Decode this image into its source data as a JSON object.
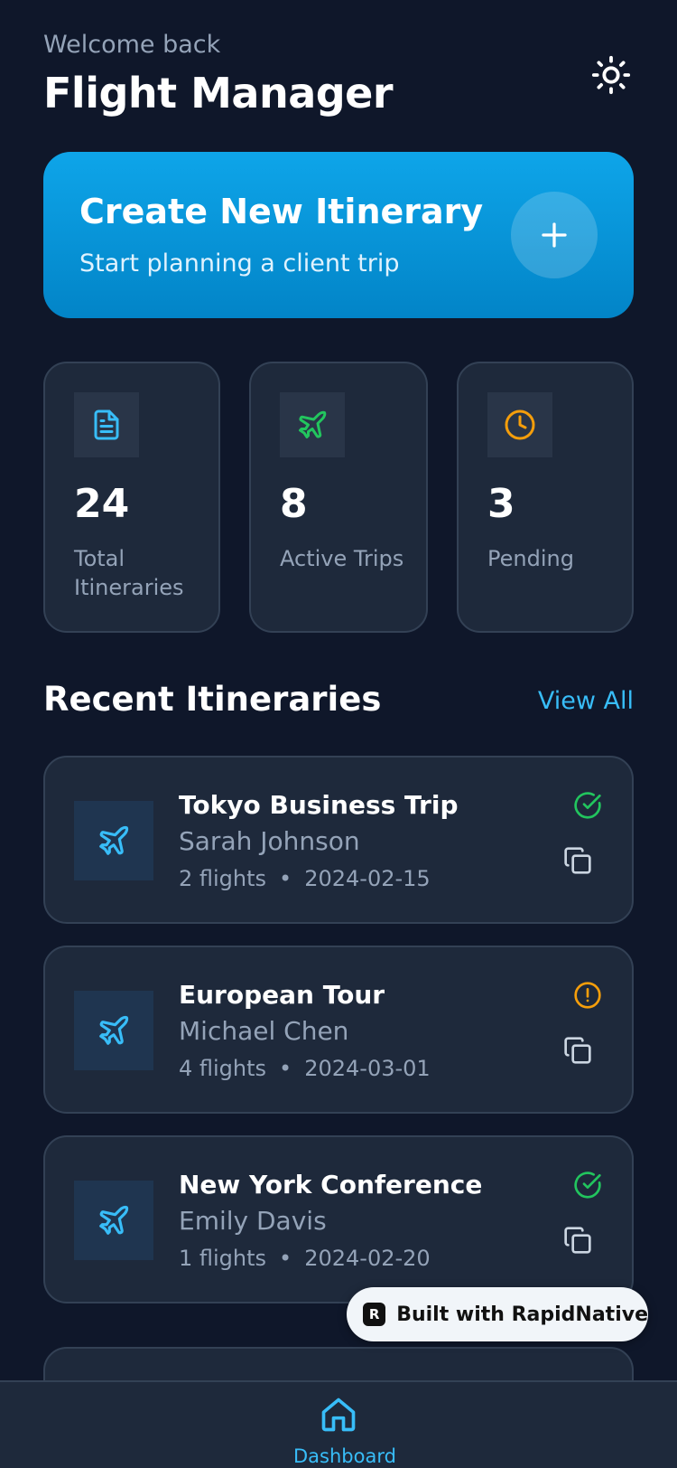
{
  "header": {
    "welcome": "Welcome back",
    "title": "Flight Manager",
    "theme_icon": "sun-icon"
  },
  "create_card": {
    "title": "Create New Itinerary",
    "subtitle": "Start planning a client trip",
    "icon": "plus-icon"
  },
  "stats": [
    {
      "value": "24",
      "label": "Total Itineraries",
      "icon": "document-icon",
      "color": "#38bdf8"
    },
    {
      "value": "8",
      "label": "Active Trips",
      "icon": "plane-icon",
      "color": "#22c55e"
    },
    {
      "value": "3",
      "label": "Pending",
      "icon": "clock-icon",
      "color": "#f59e0b"
    }
  ],
  "recent": {
    "title": "Recent Itineraries",
    "view_all": "View All",
    "items": [
      {
        "title": "Tokyo Business Trip",
        "client": "Sarah Johnson",
        "flights": "2 flights",
        "separator": "•",
        "date": "2024-02-15",
        "status": "confirmed",
        "status_icon": "check-circle-icon",
        "status_color": "#22c55e"
      },
      {
        "title": "European Tour",
        "client": "Michael Chen",
        "flights": "4 flights",
        "separator": "•",
        "date": "2024-03-01",
        "status": "pending",
        "status_icon": "alert-circle-icon",
        "status_color": "#f59e0b"
      },
      {
        "title": "New York Conference",
        "client": "Emily Davis",
        "flights": "1 flights",
        "separator": "•",
        "date": "2024-02-20",
        "status": "confirmed",
        "status_icon": "check-circle-icon",
        "status_color": "#22c55e"
      }
    ]
  },
  "badge": {
    "logo": "R",
    "text": "Built with RapidNative"
  },
  "tab_bar": {
    "items": [
      {
        "label": "Dashboard",
        "icon": "home-icon",
        "active": true
      }
    ]
  },
  "colors": {
    "background": "#0f172a",
    "card": "#1e293b",
    "accent": "#38bdf8",
    "success": "#22c55e",
    "warning": "#f59e0b"
  }
}
